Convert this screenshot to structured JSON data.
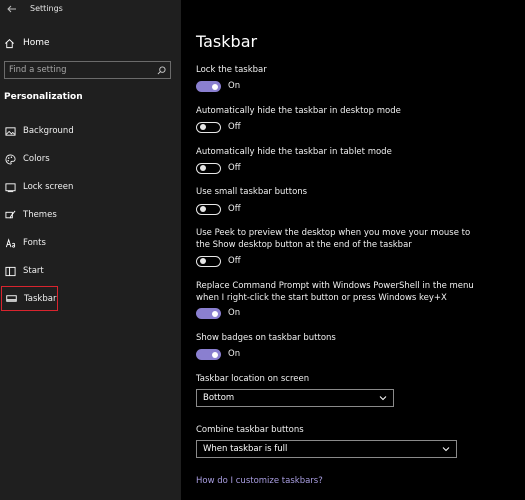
{
  "window": {
    "title": "Settings"
  },
  "sidebar": {
    "home_label": "Home",
    "search_placeholder": "Find a setting",
    "section_title": "Personalization",
    "items": [
      {
        "label": "Background",
        "icon": "picture-icon"
      },
      {
        "label": "Colors",
        "icon": "palette-icon"
      },
      {
        "label": "Lock screen",
        "icon": "lock-screen-icon"
      },
      {
        "label": "Themes",
        "icon": "brush-icon"
      },
      {
        "label": "Fonts",
        "icon": "font-icon"
      },
      {
        "label": "Start",
        "icon": "start-icon"
      },
      {
        "label": "Taskbar",
        "icon": "taskbar-icon",
        "selected": true
      }
    ]
  },
  "main": {
    "title": "Taskbar",
    "settings": [
      {
        "label": "Lock the taskbar",
        "state": "On"
      },
      {
        "label": "Automatically hide the taskbar in desktop mode",
        "state": "Off"
      },
      {
        "label": "Automatically hide the taskbar in tablet mode",
        "state": "Off"
      },
      {
        "label": "Use small taskbar buttons",
        "state": "Off"
      },
      {
        "label_line1": "Use Peek to preview the desktop when you move your mouse to",
        "label_line2": "the Show desktop button at the end of the taskbar",
        "state": "Off"
      },
      {
        "label_line1": "Replace Command Prompt with Windows PowerShell in the menu",
        "label_line2": "when I right-click the start button or press Windows key+X",
        "state": "On"
      },
      {
        "label": "Show badges on taskbar buttons",
        "state": "On"
      }
    ],
    "location": {
      "label": "Taskbar location on screen",
      "value": "Bottom"
    },
    "combine": {
      "label": "Combine taskbar buttons",
      "value": "When taskbar is full"
    },
    "help_link": "How do I customize taskbars?"
  },
  "colors": {
    "accent": "#8a7fd0",
    "selection_border": "#d9242e",
    "link": "#a89de0"
  }
}
